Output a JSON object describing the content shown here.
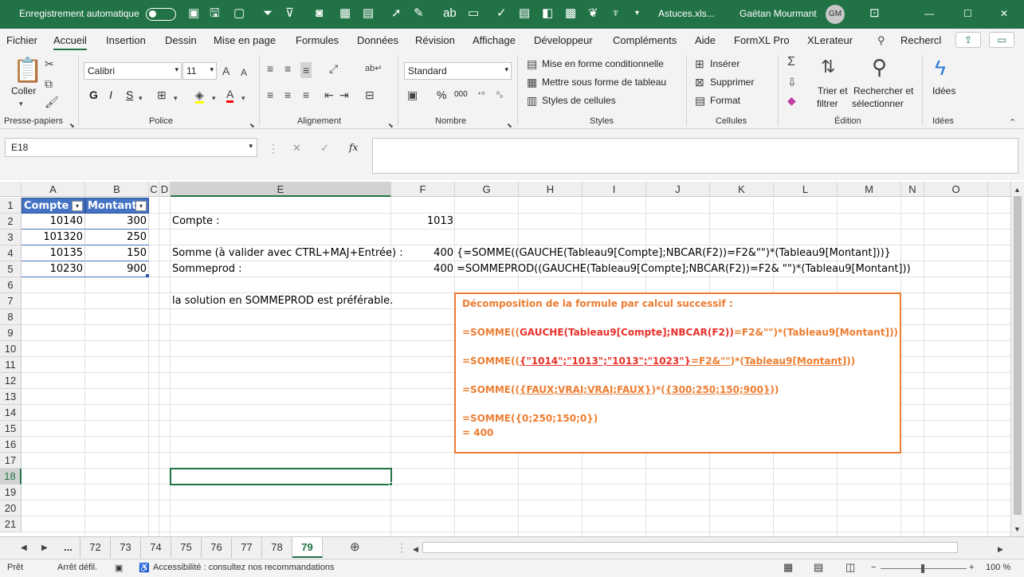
{
  "titlebar": {
    "autosave_label": "Enregistrement automatique",
    "filename": "Astuces.xls...",
    "user_name": "Gaëtan Mourmant",
    "user_initials": "GM",
    "minimize": "—",
    "maximize": "☐",
    "close": "✕"
  },
  "tabs": [
    "Fichier",
    "Accueil",
    "Insertion",
    "Dessin",
    "Mise en page",
    "Formules",
    "Données",
    "Révision",
    "Affichage",
    "Développeur",
    "Compléments",
    "Aide",
    "FormXL Pro",
    "XLerateur",
    "Rechercl"
  ],
  "ribbon": {
    "paste_label": "Coller",
    "clipboard_group": "Presse-papiers",
    "font_name": "Calibri",
    "font_size": "11",
    "bold": "G",
    "italic": "I",
    "underline": "S",
    "font_group": "Police",
    "alignment_group": "Alignement",
    "number_format": "Standard",
    "number_group": "Nombre",
    "percent": "%",
    "thousands": "000",
    "cond_format": "Mise en forme conditionnelle",
    "format_table": "Mettre sous forme de tableau",
    "cell_styles": "Styles de cellules",
    "styles_group": "Styles",
    "insert": "Insérer",
    "delete": "Supprimer",
    "format": "Format",
    "cells_group": "Cellules",
    "sort_filter_1": "Trier et",
    "sort_filter_2": "filtrer",
    "find_select_1": "Rechercher et",
    "find_select_2": "sélectionner",
    "editing_group": "Édition",
    "ideas": "Idées",
    "ideas_group": "Idées"
  },
  "formula_bar": {
    "name_box": "E18",
    "cancel": "✕",
    "enter": "✓",
    "fx": "fx",
    "formula": ""
  },
  "columns": [
    "A",
    "B",
    "C",
    "D",
    "E",
    "F",
    "G",
    "H",
    "I",
    "J",
    "K",
    "L",
    "M",
    "N",
    "O"
  ],
  "rows": [
    "1",
    "2",
    "3",
    "4",
    "5",
    "6",
    "7",
    "8",
    "9",
    "10",
    "11",
    "12",
    "13",
    "14",
    "15",
    "16",
    "17",
    "18",
    "19",
    "20",
    "21"
  ],
  "table": {
    "headers": [
      "Compte",
      "Montant"
    ],
    "rows": [
      [
        "10140",
        "300"
      ],
      [
        "101320",
        "250"
      ],
      [
        "10135",
        "150"
      ],
      [
        "10230",
        "900"
      ]
    ]
  },
  "cells": {
    "e2": "Compte :",
    "f2": "1013",
    "e4": "Somme (à valider avec CTRL+MAJ+Entrée) :",
    "f4": "400",
    "g4": "{=SOMME((GAUCHE(Tableau9[Compte];NBCAR(F2))=F2&\"\")*(Tableau9[Montant]))}",
    "e5": "Sommeprod :",
    "f5": "400",
    "g5": "=SOMMEPROD((GAUCHE(Tableau9[Compte];NBCAR(F2))=F2& \"\")*(Tableau9[Montant]))",
    "e7": "la solution en SOMMEPROD est préférable."
  },
  "note": {
    "title": "Décomposition de la formule par calcul successif :",
    "l1a": "=SOMME((",
    "l1b": "GAUCHE(Tableau9[Compte];NBCAR(F2))",
    "l1c": "=F2&\"\")*(Tableau9[Montant]))",
    "l2a": "=SOMME((",
    "l2b": "{\"1014\";\"1013\";\"1013\";\"1023\"}",
    "l2c": "=F2&\"\"",
    "l2d": ")*(",
    "l2e": "Tableau9[Montant]",
    "l2f": "))",
    "l3a": "=SOMME((",
    "l3b": "{FAUX;VRAI;VRAI;FAUX}",
    "l3c": ")*(",
    "l3d": "{300;250;150;900}",
    "l3e": "))",
    "l4": "=SOMME({0;250;150;0})",
    "l5": "= 400"
  },
  "sheet_tabs": [
    "...",
    "72",
    "73",
    "74",
    "75",
    "76",
    "77",
    "78",
    "79"
  ],
  "active_sheet": "79",
  "status": {
    "ready": "Prêt",
    "scroll_lock": "Arrêt défil.",
    "accessibility": "Accessibilité : consultez nos recommandations",
    "zoom": "100 %"
  },
  "colors": {
    "accent": "#217346",
    "table_header": "#4472c4",
    "note_border": "#ed7d31",
    "note_red": "#e8312a"
  }
}
